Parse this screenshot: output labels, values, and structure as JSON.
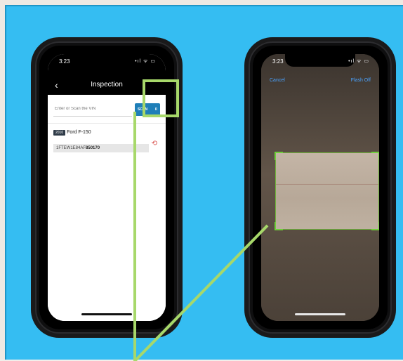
{
  "colors": {
    "panel_bg": "#35bdf2",
    "highlight": "#a7d86a",
    "scan_button": "#1f7fb8",
    "scanner_corners": "#6fcf3b"
  },
  "phones": {
    "left": {
      "status_time": "3:23",
      "status_icons": "•ıl ᯤ ▭",
      "nav_back_icon": "‹",
      "nav_title": "Inspection",
      "vin_placeholder": "Enter or Scan the VIN",
      "scan_label": "SCAN",
      "scan_icon_glyph": "⌷",
      "vehicle_year": "2010",
      "vehicle_model": "Ford F-150",
      "vin_prefix": "1FTEW1E84AF",
      "vin_suffix": "850170",
      "history_icon_glyph": "⟲"
    },
    "right": {
      "status_time": "3:23",
      "status_icons": "•ıl ᯤ ▭",
      "cancel_label": "Cancel",
      "flash_label": "Flash Off"
    }
  }
}
